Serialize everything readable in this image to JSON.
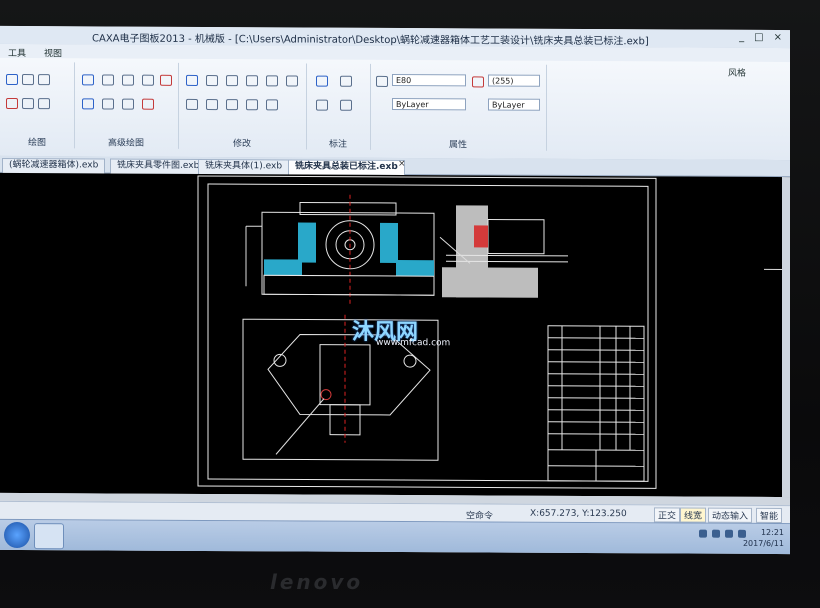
{
  "window": {
    "title": "CAXA电子图板2013 - 机械版 - [C:\\Users\\Administrator\\Desktop\\蜗轮减速器箱体工艺工装设计\\铣床夹具总装已标注.exb]",
    "minimize": "_",
    "maximize": "□",
    "close": "×"
  },
  "menu": {
    "tool": "工具",
    "view": "视图"
  },
  "ribbon": {
    "groups": [
      "绘图",
      "高级绘图",
      "修改",
      "标注",
      "属性"
    ],
    "layer_value": "ByLayer",
    "linetype_value": "ByLayer",
    "color_value": "(255)",
    "ebo": "E80",
    "style_label": "风格"
  },
  "tabs": [
    "(蜗轮减速器箱体).exb",
    "铣床夹具零件图.exb",
    "铣床夹具体(1).exb",
    "铣床夹具总装已标注.exb"
  ],
  "status": {
    "command": "空命令",
    "coordinates": "X:657.273, Y:123.250",
    "ortho": "正交",
    "linewidth": "线宽",
    "dynamic_input": "动态输入",
    "smart": "智能"
  },
  "taskbar": {
    "time": "12:21",
    "date": "2017/6/11"
  },
  "watermark": {
    "text": "沐风网",
    "url": "www.mfcad.com"
  },
  "brand": "lenovo"
}
